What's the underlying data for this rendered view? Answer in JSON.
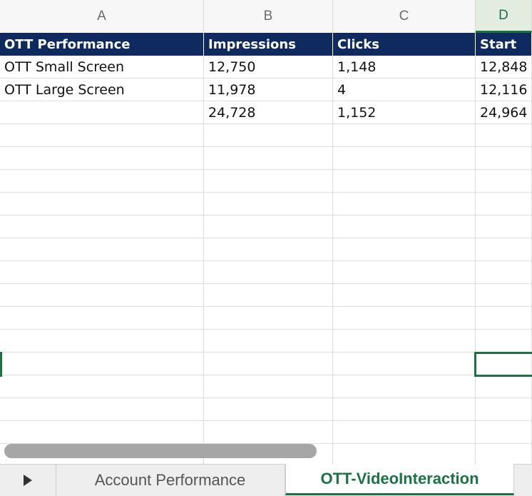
{
  "columns": [
    "A",
    "B",
    "C",
    "D"
  ],
  "selected_column": "D",
  "table": {
    "header": [
      "OTT Performance",
      "Impressions",
      "Clicks",
      "Start"
    ],
    "rows": [
      [
        "OTT Small Screen",
        "12,750",
        "1,148",
        "12,848"
      ],
      [
        "OTT Large Screen",
        "11,978",
        "4",
        "12,116"
      ],
      [
        "",
        "24,728",
        "1,152",
        "24,964"
      ]
    ]
  },
  "sheet_tabs": [
    {
      "label": "Account Performance",
      "active": false
    },
    {
      "label": "OTT-VideoInteraction",
      "active": true
    }
  ],
  "colors": {
    "header_fill": "#0f2a5f",
    "accent_green": "#1e7145"
  },
  "icons": {
    "tab_nav": "play-right-triangle"
  }
}
